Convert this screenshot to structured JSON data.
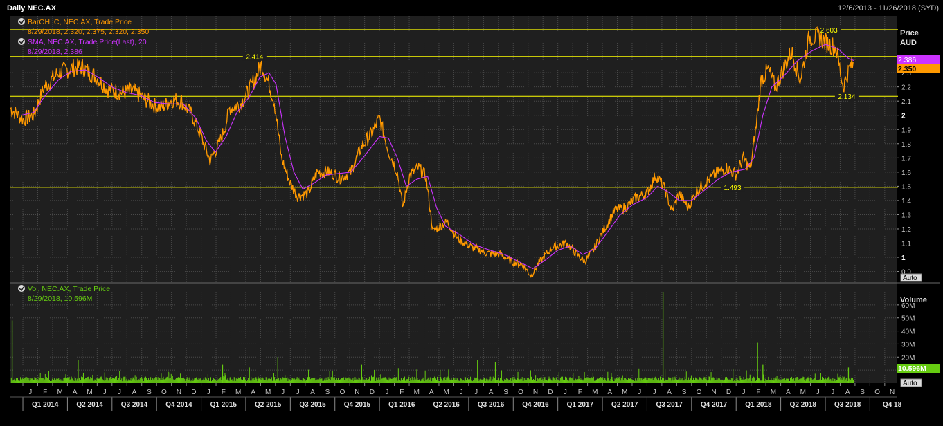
{
  "window": {
    "title": "Daily NEC.AX",
    "date_range": "12/6/2013 - 11/26/2018 (SYD)"
  },
  "colors": {
    "ohlc": "#ff9900",
    "sma": "#cc33ff",
    "volume": "#66cc11",
    "hline": "#ffff00",
    "grid": "#4a4a4a",
    "text": "#c8c8c8",
    "background": "#1f1f1f"
  },
  "price_panel": {
    "legend_ohlc_title": "BarOHLC, NEC.AX, Trade Price",
    "legend_ohlc_values": "8/29/2018, 2.320, 2.375, 2.320, 2.350",
    "legend_sma_title": "SMA, NEC.AX, Trade Price(Last),  20",
    "legend_sma_values": "8/29/2018, 2.386",
    "axis_title_1": "Price",
    "axis_title_2": "AUD",
    "auto_label": "Auto",
    "last_sma_tag": "2.386",
    "last_price_tag": "2.350"
  },
  "volume_panel": {
    "legend_title": "Vol, NEC.AX, Trade Price",
    "legend_values": "8/29/2018, 10.596M",
    "axis_title": "Volume",
    "last_tag": "10.596M",
    "auto_label": "Auto"
  },
  "chart_data": {
    "type": "line",
    "price": {
      "ylim": [
        0.82,
        2.7
      ],
      "yticks": [
        0.9,
        1,
        1.1,
        1.2,
        1.3,
        1.4,
        1.5,
        1.6,
        1.7,
        1.8,
        1.9,
        2,
        2.1,
        2.2,
        2.3
      ],
      "ytick_labels": [
        "0.9",
        "1",
        "1.1",
        "1.2",
        "1.3",
        "1.4",
        "1.5",
        "1.6",
        "1.7",
        "1.8",
        "1.9",
        "2",
        "2.1",
        "2.2",
        "2.3"
      ],
      "xlim": [
        "2013-12-06",
        "2018-11-26"
      ],
      "series": [
        {
          "values": [
            [
              2013.93,
              2.05
            ],
            [
              2014.0,
              1.97
            ],
            [
              2014.06,
              2.0
            ],
            [
              2014.12,
              2.2
            ],
            [
              2014.2,
              2.3
            ],
            [
              2014.27,
              2.33
            ],
            [
              2014.33,
              2.34
            ],
            [
              2014.41,
              2.27
            ],
            [
              2014.48,
              2.18
            ],
            [
              2014.56,
              2.16
            ],
            [
              2014.62,
              2.17
            ],
            [
              2014.7,
              2.1
            ],
            [
              2014.77,
              2.05
            ],
            [
              2014.84,
              2.11
            ],
            [
              2014.89,
              2.1
            ],
            [
              2014.95,
              2.0
            ],
            [
              2015.0,
              1.85
            ],
            [
              2015.05,
              1.68
            ],
            [
              2015.1,
              1.8
            ],
            [
              2015.13,
              1.9
            ],
            [
              2015.16,
              2.05
            ],
            [
              2015.22,
              2.08
            ],
            [
              2015.28,
              2.2
            ],
            [
              2015.34,
              2.36
            ],
            [
              2015.38,
              2.22
            ],
            [
              2015.41,
              2.1
            ],
            [
              2015.45,
              1.7
            ],
            [
              2015.5,
              1.52
            ],
            [
              2015.54,
              1.43
            ],
            [
              2015.6,
              1.45
            ],
            [
              2015.65,
              1.6
            ],
            [
              2015.72,
              1.6
            ],
            [
              2015.78,
              1.56
            ],
            [
              2015.84,
              1.6
            ],
            [
              2015.9,
              1.78
            ],
            [
              2015.96,
              1.88
            ],
            [
              2016.0,
              1.98
            ],
            [
              2016.05,
              1.75
            ],
            [
              2016.1,
              1.6
            ],
            [
              2016.13,
              1.35
            ],
            [
              2016.17,
              1.58
            ],
            [
              2016.22,
              1.63
            ],
            [
              2016.26,
              1.57
            ],
            [
              2016.3,
              1.18
            ],
            [
              2016.34,
              1.22
            ],
            [
              2016.38,
              1.25
            ],
            [
              2016.44,
              1.13
            ],
            [
              2016.52,
              1.07
            ],
            [
              2016.6,
              1.03
            ],
            [
              2016.68,
              1.02
            ],
            [
              2016.74,
              0.97
            ],
            [
              2016.8,
              0.95
            ],
            [
              2016.85,
              0.87
            ],
            [
              2016.9,
              0.97
            ],
            [
              2016.97,
              1.07
            ],
            [
              2017.05,
              1.1
            ],
            [
              2017.1,
              1.03
            ],
            [
              2017.15,
              0.97
            ],
            [
              2017.2,
              1.05
            ],
            [
              2017.26,
              1.2
            ],
            [
              2017.32,
              1.33
            ],
            [
              2017.38,
              1.35
            ],
            [
              2017.44,
              1.42
            ],
            [
              2017.5,
              1.45
            ],
            [
              2017.55,
              1.58
            ],
            [
              2017.6,
              1.48
            ],
            [
              2017.64,
              1.32
            ],
            [
              2017.68,
              1.45
            ],
            [
              2017.73,
              1.35
            ],
            [
              2017.78,
              1.47
            ],
            [
              2017.85,
              1.55
            ],
            [
              2017.9,
              1.6
            ],
            [
              2017.95,
              1.63
            ],
            [
              2018.0,
              1.58
            ],
            [
              2018.04,
              1.7
            ],
            [
              2018.08,
              1.62
            ],
            [
              2018.11,
              1.9
            ],
            [
              2018.14,
              2.25
            ],
            [
              2018.18,
              2.32
            ],
            [
              2018.22,
              2.2
            ],
            [
              2018.27,
              2.34
            ],
            [
              2018.31,
              2.45
            ],
            [
              2018.36,
              2.25
            ],
            [
              2018.41,
              2.55
            ],
            [
              2018.46,
              2.55
            ],
            [
              2018.52,
              2.5
            ],
            [
              2018.56,
              2.48
            ],
            [
              2018.6,
              2.2
            ],
            [
              2018.64,
              2.35
            ],
            [
              2018.66,
              2.35
            ]
          ]
        },
        {
          "name": "SMA 20",
          "values": [
            [
              2013.99,
              2.0
            ],
            [
              2014.06,
              2.02
            ],
            [
              2014.12,
              2.13
            ],
            [
              2014.2,
              2.25
            ],
            [
              2014.27,
              2.31
            ],
            [
              2014.35,
              2.32
            ],
            [
              2014.42,
              2.27
            ],
            [
              2014.5,
              2.2
            ],
            [
              2014.58,
              2.16
            ],
            [
              2014.66,
              2.14
            ],
            [
              2014.74,
              2.09
            ],
            [
              2014.82,
              2.08
            ],
            [
              2014.9,
              2.08
            ],
            [
              2014.97,
              1.98
            ],
            [
              2015.03,
              1.82
            ],
            [
              2015.08,
              1.74
            ],
            [
              2015.14,
              1.85
            ],
            [
              2015.2,
              2.02
            ],
            [
              2015.27,
              2.13
            ],
            [
              2015.33,
              2.27
            ],
            [
              2015.38,
              2.3
            ],
            [
              2015.42,
              2.22
            ],
            [
              2015.47,
              1.85
            ],
            [
              2015.52,
              1.6
            ],
            [
              2015.57,
              1.48
            ],
            [
              2015.63,
              1.52
            ],
            [
              2015.7,
              1.58
            ],
            [
              2015.77,
              1.59
            ],
            [
              2015.84,
              1.6
            ],
            [
              2015.92,
              1.72
            ],
            [
              2016.0,
              1.85
            ],
            [
              2016.05,
              1.84
            ],
            [
              2016.1,
              1.7
            ],
            [
              2016.15,
              1.5
            ],
            [
              2016.21,
              1.55
            ],
            [
              2016.27,
              1.57
            ],
            [
              2016.32,
              1.35
            ],
            [
              2016.37,
              1.22
            ],
            [
              2016.45,
              1.16
            ],
            [
              2016.53,
              1.09
            ],
            [
              2016.62,
              1.05
            ],
            [
              2016.7,
              1.02
            ],
            [
              2016.78,
              0.97
            ],
            [
              2016.86,
              0.92
            ],
            [
              2016.93,
              0.98
            ],
            [
              2017.0,
              1.05
            ],
            [
              2017.07,
              1.08
            ],
            [
              2017.14,
              1.02
            ],
            [
              2017.21,
              1.06
            ],
            [
              2017.28,
              1.18
            ],
            [
              2017.35,
              1.3
            ],
            [
              2017.42,
              1.37
            ],
            [
              2017.5,
              1.42
            ],
            [
              2017.56,
              1.5
            ],
            [
              2017.62,
              1.46
            ],
            [
              2017.68,
              1.4
            ],
            [
              2017.75,
              1.4
            ],
            [
              2017.82,
              1.47
            ],
            [
              2017.9,
              1.55
            ],
            [
              2017.97,
              1.6
            ],
            [
              2018.05,
              1.62
            ],
            [
              2018.1,
              1.7
            ],
            [
              2018.15,
              2.0
            ],
            [
              2018.2,
              2.2
            ],
            [
              2018.27,
              2.28
            ],
            [
              2018.34,
              2.38
            ],
            [
              2018.42,
              2.45
            ],
            [
              2018.5,
              2.5
            ],
            [
              2018.57,
              2.47
            ],
            [
              2018.63,
              2.4
            ],
            [
              2018.66,
              2.386
            ]
          ]
        }
      ],
      "reference_lines": [
        {
          "value": 2.603,
          "label": "2.603"
        },
        {
          "value": 2.414,
          "label": "2.414"
        },
        {
          "value": 2.134,
          "label": "2.134"
        },
        {
          "value": 1.493,
          "label": "1.493"
        }
      ]
    },
    "volume": {
      "ylim": [
        0,
        70
      ],
      "yticks": [
        10,
        20,
        30,
        40,
        50,
        60
      ],
      "ytick_labels": [
        "M",
        "20M",
        "30M",
        "40M",
        "50M",
        "60M"
      ],
      "spikes": [
        [
          2013.94,
          48
        ],
        [
          2014.31,
          18
        ],
        [
          2014.34,
          8
        ],
        [
          2015.12,
          14
        ],
        [
          2015.27,
          12
        ],
        [
          2015.43,
          20
        ],
        [
          2015.9,
          14
        ],
        [
          2016.34,
          10
        ],
        [
          2016.55,
          18
        ],
        [
          2016.65,
          16
        ],
        [
          2017.59,
          70
        ],
        [
          2018.12,
          31
        ],
        [
          2018.15,
          14
        ],
        [
          2018.63,
          12
        ]
      ],
      "series_last": 10.596
    },
    "x_axis": {
      "month_labels": [
        "J",
        "F",
        "M",
        "A",
        "M",
        "J",
        "J",
        "A",
        "S",
        "O",
        "N",
        "D",
        "J",
        "F",
        "M",
        "A",
        "M",
        "J",
        "J",
        "A",
        "S",
        "O",
        "N",
        "D",
        "J",
        "F",
        "M",
        "A",
        "M",
        "J",
        "J",
        "A",
        "S",
        "O",
        "N",
        "D",
        "J",
        "F",
        "M",
        "A",
        "M",
        "J",
        "J",
        "A",
        "S",
        "O",
        "N",
        "D",
        "J",
        "F",
        "M",
        "A",
        "M",
        "J",
        "J",
        "A",
        "S",
        "O",
        "N"
      ],
      "quarter_labels": [
        "Q1 2014",
        "Q2 2014",
        "Q3 2014",
        "Q4 2014",
        "Q1 2015",
        "Q2 2015",
        "Q3 2015",
        "Q4 2015",
        "Q1 2016",
        "Q2 2016",
        "Q3 2016",
        "Q4 2016",
        "Q1 2017",
        "Q2 2017",
        "Q3 2017",
        "Q4 2017",
        "Q1 2018",
        "Q2 2018",
        "Q3 2018",
        "Q4 18"
      ]
    }
  }
}
